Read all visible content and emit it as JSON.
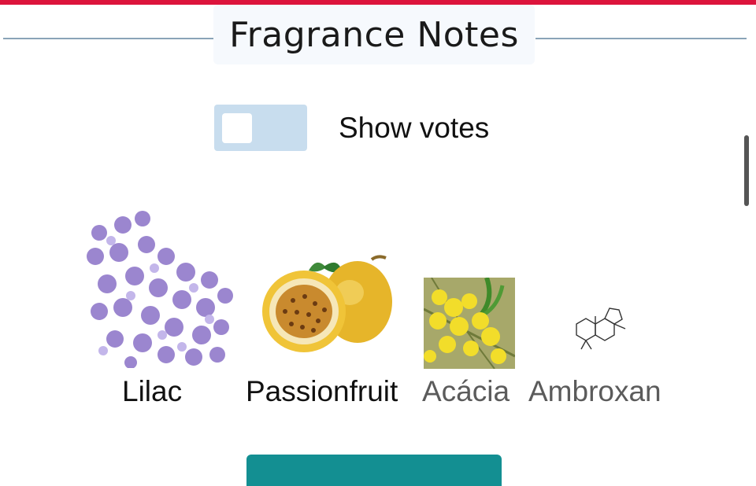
{
  "header": {
    "title": "Fragrance Notes"
  },
  "toggle": {
    "label": "Show votes",
    "on": false
  },
  "notes": [
    {
      "name": "Lilac",
      "icon": "lilac-flower-image"
    },
    {
      "name": "Passionfruit",
      "icon": "passionfruit-image"
    },
    {
      "name": "Acácia",
      "icon": "acacia-flower-image"
    },
    {
      "name": "Ambroxan",
      "icon": "ambroxan-molecule-image"
    }
  ],
  "colors": {
    "accent": "#dc143c",
    "toggle_track": "#c8ddee",
    "button": "#138f92",
    "rule": "#8aa4b8"
  }
}
